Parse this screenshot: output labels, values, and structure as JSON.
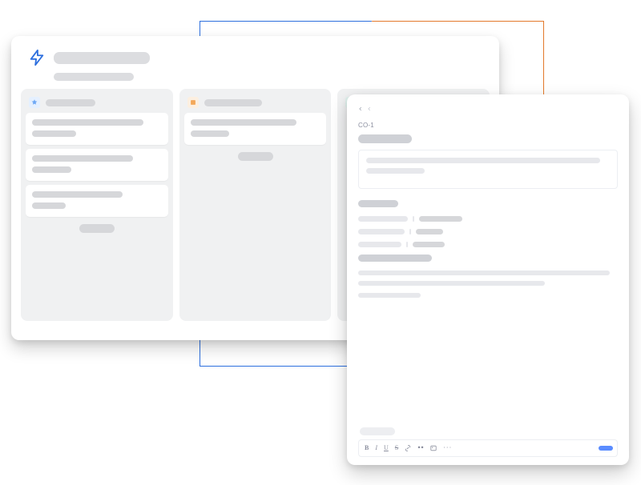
{
  "colors": {
    "frame_blue": "#2d6fde",
    "frame_orange": "#e3792b",
    "bolt": "#2d6fde",
    "col_icon_1": "#6fa9f5",
    "col_icon_2": "#f3a85a",
    "col_icon_3": "#63b7a9",
    "send_btn": "#5a8cff"
  },
  "board": {
    "icon": "bolt-icon",
    "title": "",
    "subtitle": "",
    "columns": [
      {
        "icon": "star-icon",
        "name": "",
        "cards": [
          {
            "lines": [
              "",
              ""
            ]
          },
          {
            "lines": [
              "",
              ""
            ]
          },
          {
            "lines": [
              "",
              ""
            ]
          }
        ],
        "footer_chip": ""
      },
      {
        "icon": "box-icon",
        "name": "",
        "cards": [
          {
            "lines": [
              "",
              ""
            ]
          }
        ],
        "footer_chip": ""
      },
      {
        "icon": "badge-icon",
        "name": "",
        "cards": [],
        "footer_chip": null
      }
    ]
  },
  "detail": {
    "breadcrumb_icons": [
      "chevron-left-icon",
      "chevron-left-icon"
    ],
    "id": "CO-1",
    "title": "",
    "timestamp": "",
    "description_lines": [
      "",
      ""
    ],
    "detail_section_label": "",
    "kv": [
      {
        "key": "",
        "value": ""
      },
      {
        "key": "",
        "value": ""
      },
      {
        "key": "",
        "value": ""
      }
    ],
    "second_section_label": "",
    "paragraph_lines": [
      "",
      "",
      ""
    ],
    "reply_label": "",
    "toolbar_icons": [
      "bold-icon",
      "italic-icon",
      "underline-icon",
      "strike-icon",
      "link-icon",
      "quote-icon",
      "image-icon",
      "three-dots-icon"
    ],
    "send_label": ""
  }
}
